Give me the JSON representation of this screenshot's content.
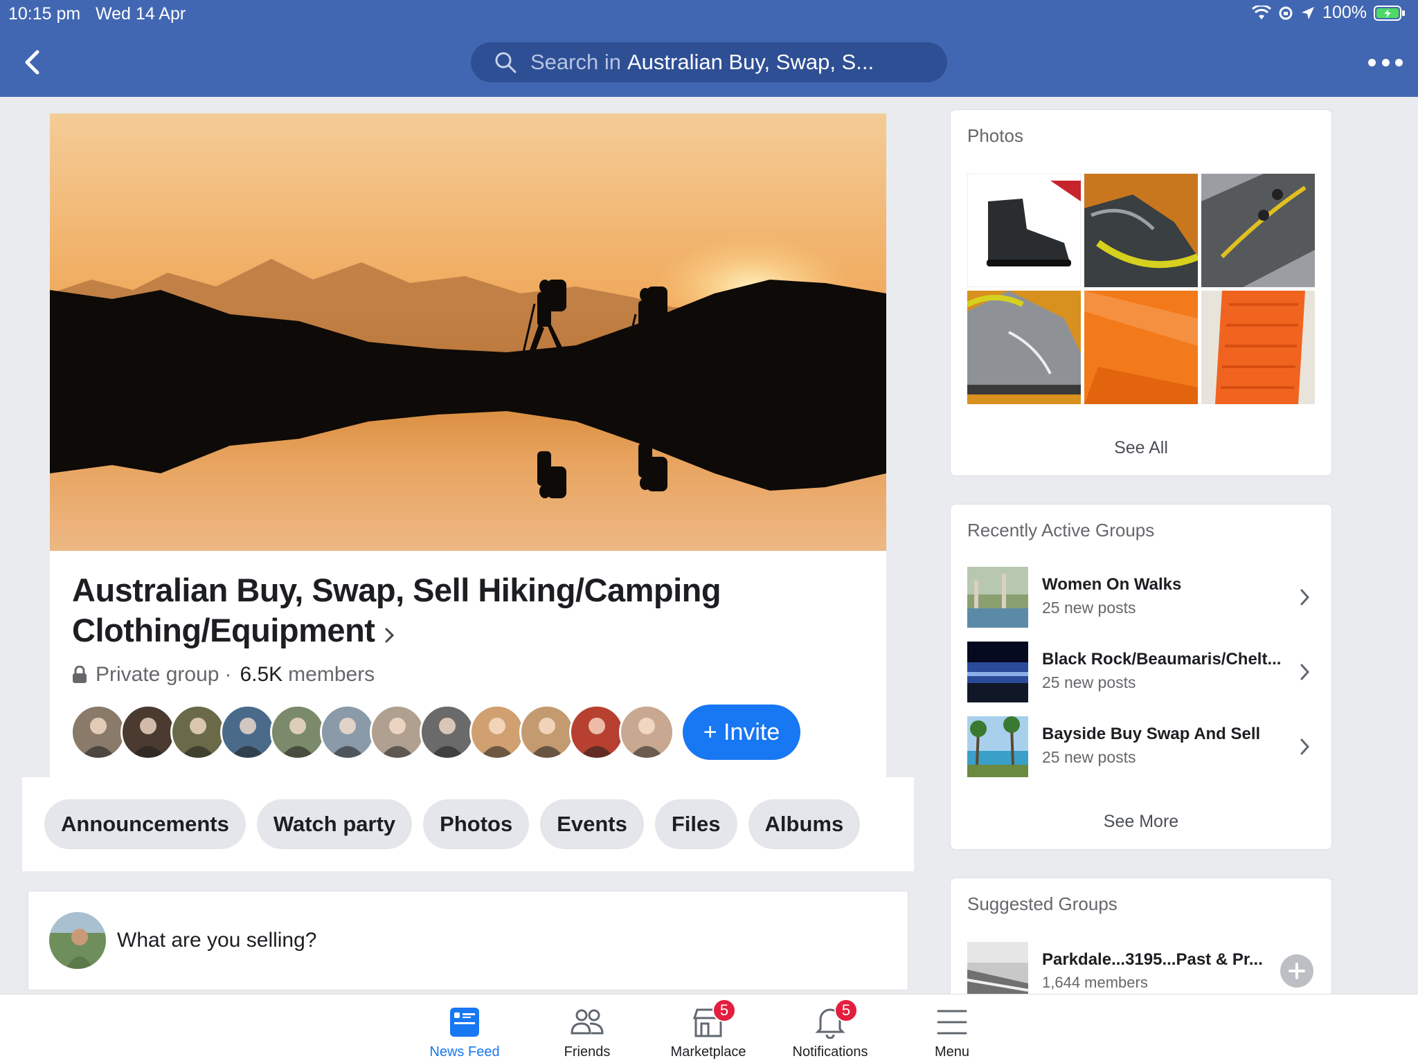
{
  "status_bar": {
    "time": "10:15 pm",
    "date": "Wed 14 Apr",
    "battery": "100%"
  },
  "header": {
    "search_prefix": "Search in",
    "search_scope": "Australian Buy, Swap, S..."
  },
  "group": {
    "title": "Australian Buy, Swap, Sell Hiking/Camping Clothing/Equipment",
    "privacy": "Private group",
    "separator": "·",
    "member_count": "6.5K",
    "members_word": "members",
    "invite_label": "+ Invite",
    "member_avatar_colors": [
      "#8a7a6a",
      "#4a3a30",
      "#6a6a48",
      "#4a6a8a",
      "#7a8a6a",
      "#8a9aa8",
      "#b0a090",
      "#6a6a6a",
      "#d0a070",
      "#c49a70",
      "#b84030",
      "#c8a890"
    ]
  },
  "tabs": [
    "Announcements",
    "Watch party",
    "Photos",
    "Events",
    "Files",
    "Albums"
  ],
  "composer": {
    "placeholder": "What are you selling?"
  },
  "photos_panel": {
    "title": "Photos",
    "see_all": "See All"
  },
  "recent_groups": {
    "title": "Recently Active Groups",
    "items": [
      {
        "name": "Women On Walks",
        "sub": "25 new posts"
      },
      {
        "name": "Black Rock/Beaumaris/Chelt...",
        "sub": "25 new posts"
      },
      {
        "name": "Bayside Buy Swap And Sell",
        "sub": "25 new posts"
      }
    ],
    "see_more": "See More"
  },
  "suggested_groups": {
    "title": "Suggested Groups",
    "item": {
      "name": "Parkdale...3195...Past & Pr...",
      "sub": "1,644 members"
    }
  },
  "bottom_nav": [
    {
      "label": "News Feed",
      "active": true
    },
    {
      "label": "Friends"
    },
    {
      "label": "Marketplace",
      "badge": "5"
    },
    {
      "label": "Notifications",
      "badge": "5"
    },
    {
      "label": "Menu"
    }
  ],
  "colors": {
    "brand": "#4267b2",
    "accent": "#1877f2",
    "badge": "#e41e3f"
  }
}
